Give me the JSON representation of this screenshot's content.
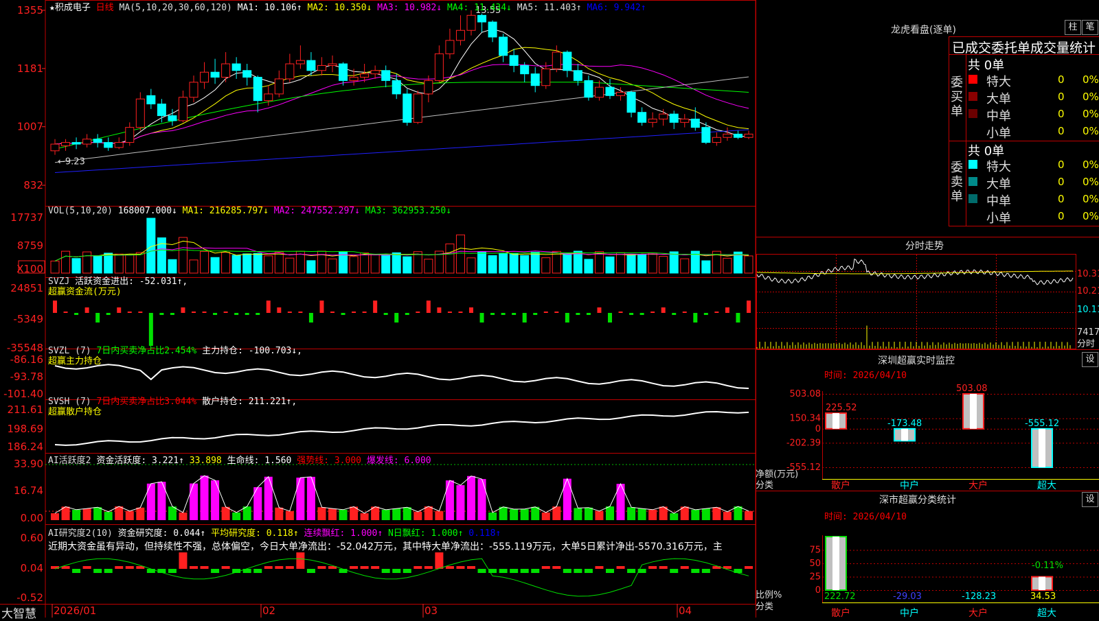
{
  "stock": {
    "star": "★",
    "name": "积成电子",
    "period": "日线"
  },
  "price_header": {
    "ma_spec": "MA(5,10,20,30,60,120)",
    "ma1": "MA1: 10.106↑",
    "ma2": "MA2: 10.350↓",
    "ma3": "MA3: 10.982↓",
    "ma4": "MA4: 11.434↓",
    "ma5": "MA5: 11.403↑",
    "ma6": "MA6: 9.942↑"
  },
  "price_axis": [
    "1355",
    "1181",
    "1007",
    "832"
  ],
  "price_annotations": {
    "high": "13.55",
    "low": "9.23"
  },
  "vol_header": {
    "spec": "VOL(5,10,20)",
    "value": "168007.000↓",
    "ma1": "MA1: 216285.797↓",
    "ma2": "MA2: 247552.297↓",
    "ma3": "MA3: 362953.250↓"
  },
  "vol_axis": [
    "17737",
    "8759",
    "X100"
  ],
  "svzj": {
    "title": "SVZJ",
    "desc": "活跃资金进出: -52.031↑,",
    "sub": "超赢资金流(万元)",
    "axis": [
      "24851",
      "-5349",
      "-35548"
    ]
  },
  "svzl": {
    "title": "SVZL (7)",
    "a": "7日内买卖净占比2.454%",
    "b": "主力持仓: -100.703↓,",
    "sub": "超赢主力持仓",
    "axis": [
      "-86.16",
      "-93.78",
      "-101.40"
    ]
  },
  "svsh": {
    "title": "SVSH (7)",
    "a": "7日内买卖净占比3.044%",
    "b": "散户持仓: 211.221↑,",
    "sub": "超赢散户持仓",
    "axis": [
      "211.61",
      "198.69",
      "186.24"
    ]
  },
  "ai2": {
    "title": "AI活跃度2",
    "a": "资金活跃度: 3.221↑",
    "b": "33.898",
    "c": "生命线: 1.560",
    "d": "强势线: 3.000",
    "e": "爆发线: 6.000",
    "axis": [
      "33.90",
      "16.74",
      "0.00"
    ]
  },
  "ai_research": {
    "title": "AI研究度2(10)",
    "a": "资金研究度: 0.044↑",
    "b": "平均研究度: 0.118↑",
    "c": "连续飘红: 1.000↑",
    "d": "N日飘红: 1.000↑",
    "e": "0.118↑",
    "text": "近期大资金虽有异动，但持续性不强，总体偏空，今日大单净流出：-52.042万元，其中特大单净流出：-555.119万元，大单5日累计净出-5570.316万元，主",
    "axis": [
      "0.60",
      "0.04",
      "-0.52"
    ]
  },
  "date_axis": [
    "2026/01",
    "02",
    "03",
    "04"
  ],
  "brand": "大智慧",
  "side": {
    "lhb_title": "龙虎看盘(逐单)",
    "btn_zhu": "柱",
    "btn_bi": "笔",
    "deal_header": "已成交委托单成交量统计",
    "buy_label": "委买单",
    "sell_label": "委卖单",
    "buy_total": "共 0单",
    "sell_total": "共 0单",
    "buy_rows": [
      {
        "name": "特大",
        "count": "0",
        "pct": "0%",
        "color": "#ff0000"
      },
      {
        "name": "大单",
        "count": "0",
        "pct": "0%",
        "color": "#8b0000"
      },
      {
        "name": "中单",
        "count": "0",
        "pct": "0%",
        "color": "#6b0000"
      },
      {
        "name": "小单",
        "count": "0",
        "pct": "0%",
        "color": ""
      }
    ],
    "sell_rows": [
      {
        "name": "特大",
        "count": "0",
        "pct": "0%",
        "color": "#00ffff"
      },
      {
        "name": "大单",
        "count": "0",
        "pct": "0%",
        "color": "#008b8b"
      },
      {
        "name": "中单",
        "count": "0",
        "pct": "0%",
        "color": "#006b6b"
      },
      {
        "name": "小单",
        "count": "0",
        "pct": "0%",
        "color": ""
      }
    ],
    "intraday_title": "分时走势",
    "intraday_axis": [
      "10.31",
      "10.21",
      "10.11"
    ],
    "intraday_vol": "7417",
    "intraday_vol_unit": "分时",
    "monitor_title": "深圳超赢实时监控",
    "monitor_time": "时间: 2026/04/10",
    "btn_set": "设",
    "monitor_axis": [
      "503.08",
      "150.34",
      "0",
      "-202.39",
      "-555.12"
    ],
    "monitor_ylabel": "净额(万元)",
    "monitor_xlabel": "分类",
    "class_title": "深市超赢分类统计",
    "class_time": "时间: 2026/04/10",
    "class_axis": [
      "75",
      "50",
      "25",
      "0"
    ],
    "class_ylabel": "比例%",
    "class_xlabel": "分类"
  },
  "chart_data": [
    {
      "type": "bar",
      "title": "深圳超赢实时监控",
      "categories": [
        "散户",
        "中户",
        "大户",
        "超大"
      ],
      "values": [
        225.52,
        -173.48,
        503.08,
        -555.12
      ],
      "ylabel": "净额(万元)",
      "xlabel": "分类",
      "ylim": [
        -555.12,
        503.08
      ]
    },
    {
      "type": "bar",
      "title": "深市超赢分类统计",
      "categories": [
        "散户",
        "中户",
        "大户",
        "超大"
      ],
      "values": [
        222.72,
        -29.03,
        -128.23,
        34.53
      ],
      "bar_label": "-0.11%",
      "ylabel": "比例%",
      "xlabel": "分类",
      "ylim": [
        0,
        100
      ]
    },
    {
      "type": "candlestick",
      "title": "积成电子 日线",
      "x": [
        "2026/01",
        "02",
        "03",
        "04"
      ],
      "ylim": [
        8.32,
        13.55
      ],
      "high": 13.55,
      "low": 9.23,
      "candles": [
        {
          "o": 9.35,
          "c": 9.55,
          "h": 9.7,
          "l": 9.23
        },
        {
          "o": 9.5,
          "c": 9.6,
          "h": 9.7,
          "l": 9.35
        },
        {
          "o": 9.6,
          "c": 9.55,
          "h": 9.75,
          "l": 9.4
        },
        {
          "o": 9.55,
          "c": 9.7,
          "h": 9.85,
          "l": 9.45
        },
        {
          "o": 9.7,
          "c": 9.6,
          "h": 9.85,
          "l": 9.45
        },
        {
          "o": 9.6,
          "c": 9.45,
          "h": 9.75,
          "l": 9.35
        },
        {
          "o": 9.45,
          "c": 9.6,
          "h": 9.75,
          "l": 9.4
        },
        {
          "o": 9.6,
          "c": 10.05,
          "h": 10.2,
          "l": 9.5
        },
        {
          "o": 10.05,
          "c": 10.9,
          "h": 11.1,
          "l": 9.95
        },
        {
          "o": 11.0,
          "c": 10.75,
          "h": 11.2,
          "l": 10.6
        },
        {
          "o": 10.75,
          "c": 10.4,
          "h": 10.9,
          "l": 10.2
        },
        {
          "o": 10.4,
          "c": 10.25,
          "h": 10.6,
          "l": 10.1
        },
        {
          "o": 10.25,
          "c": 10.95,
          "h": 11.15,
          "l": 10.2
        },
        {
          "o": 10.95,
          "c": 11.4,
          "h": 11.6,
          "l": 10.8
        },
        {
          "o": 11.4,
          "c": 11.7,
          "h": 12.0,
          "l": 11.2
        },
        {
          "o": 11.7,
          "c": 11.55,
          "h": 12.1,
          "l": 11.35
        },
        {
          "o": 11.55,
          "c": 11.95,
          "h": 12.3,
          "l": 11.4
        },
        {
          "o": 11.95,
          "c": 11.75,
          "h": 12.15,
          "l": 11.5
        },
        {
          "o": 11.75,
          "c": 11.55,
          "h": 11.95,
          "l": 11.3
        },
        {
          "o": 11.55,
          "c": 10.85,
          "h": 11.6,
          "l": 10.5
        },
        {
          "o": 10.85,
          "c": 11.05,
          "h": 11.3,
          "l": 10.7
        },
        {
          "o": 11.05,
          "c": 11.5,
          "h": 11.75,
          "l": 10.95
        },
        {
          "o": 11.5,
          "c": 11.95,
          "h": 12.25,
          "l": 11.4
        },
        {
          "o": 11.95,
          "c": 12.05,
          "h": 12.5,
          "l": 11.8
        },
        {
          "o": 12.05,
          "c": 11.75,
          "h": 12.3,
          "l": 11.6
        },
        {
          "o": 11.75,
          "c": 11.9,
          "h": 12.15,
          "l": 11.6
        },
        {
          "o": 11.9,
          "c": 11.95,
          "h": 12.2,
          "l": 11.7
        },
        {
          "o": 11.95,
          "c": 11.45,
          "h": 12.0,
          "l": 11.3
        },
        {
          "o": 11.45,
          "c": 11.55,
          "h": 11.8,
          "l": 11.3
        },
        {
          "o": 11.55,
          "c": 11.65,
          "h": 11.95,
          "l": 11.4
        },
        {
          "o": 11.65,
          "c": 11.75,
          "h": 11.9,
          "l": 11.5
        },
        {
          "o": 11.75,
          "c": 11.45,
          "h": 11.9,
          "l": 11.25
        },
        {
          "o": 11.45,
          "c": 11.05,
          "h": 11.65,
          "l": 10.9
        },
        {
          "o": 11.05,
          "c": 10.2,
          "h": 11.2,
          "l": 10.1
        },
        {
          "o": 10.2,
          "c": 11.05,
          "h": 11.15,
          "l": 10.15
        },
        {
          "o": 11.05,
          "c": 11.45,
          "h": 11.6,
          "l": 10.8
        },
        {
          "o": 11.45,
          "c": 12.25,
          "h": 12.5,
          "l": 11.4
        },
        {
          "o": 12.25,
          "c": 12.65,
          "h": 13.0,
          "l": 12.1
        },
        {
          "o": 12.65,
          "c": 12.95,
          "h": 13.4,
          "l": 12.5
        },
        {
          "o": 12.95,
          "c": 13.4,
          "h": 13.55,
          "l": 12.8
        },
        {
          "o": 13.4,
          "c": 13.2,
          "h": 13.45,
          "l": 12.9
        },
        {
          "o": 13.2,
          "c": 12.75,
          "h": 13.25,
          "l": 12.6
        },
        {
          "o": 12.75,
          "c": 12.2,
          "h": 12.85,
          "l": 12.0
        },
        {
          "o": 12.2,
          "c": 11.9,
          "h": 12.4,
          "l": 11.7
        },
        {
          "o": 11.9,
          "c": 11.65,
          "h": 12.0,
          "l": 11.4
        },
        {
          "o": 11.65,
          "c": 11.3,
          "h": 11.85,
          "l": 11.1
        },
        {
          "o": 11.3,
          "c": 11.8,
          "h": 12.0,
          "l": 11.2
        },
        {
          "o": 11.8,
          "c": 12.3,
          "h": 12.5,
          "l": 11.7
        },
        {
          "o": 12.3,
          "c": 11.75,
          "h": 12.35,
          "l": 11.55
        },
        {
          "o": 11.75,
          "c": 11.45,
          "h": 11.95,
          "l": 11.3
        },
        {
          "o": 11.45,
          "c": 10.95,
          "h": 11.6,
          "l": 10.85
        },
        {
          "o": 10.95,
          "c": 11.25,
          "h": 11.45,
          "l": 10.85
        },
        {
          "o": 11.25,
          "c": 11.0,
          "h": 11.5,
          "l": 10.9
        },
        {
          "o": 11.0,
          "c": 11.1,
          "h": 11.25,
          "l": 10.85
        },
        {
          "o": 11.1,
          "c": 10.5,
          "h": 11.15,
          "l": 10.35
        },
        {
          "o": 10.5,
          "c": 10.2,
          "h": 10.65,
          "l": 10.1
        },
        {
          "o": 10.2,
          "c": 10.3,
          "h": 10.5,
          "l": 10.05
        },
        {
          "o": 10.3,
          "c": 10.45,
          "h": 10.6,
          "l": 10.1
        },
        {
          "o": 10.45,
          "c": 10.2,
          "h": 10.55,
          "l": 10.0
        },
        {
          "o": 10.2,
          "c": 10.3,
          "h": 10.45,
          "l": 10.05
        },
        {
          "o": 10.3,
          "c": 10.05,
          "h": 10.65,
          "l": 9.95
        },
        {
          "o": 10.05,
          "c": 9.6,
          "h": 10.2,
          "l": 9.55
        },
        {
          "o": 9.6,
          "c": 9.75,
          "h": 9.9,
          "l": 9.5
        },
        {
          "o": 9.75,
          "c": 9.85,
          "h": 10.05,
          "l": 9.65
        },
        {
          "o": 9.85,
          "c": 9.75,
          "h": 9.95,
          "l": 9.7
        },
        {
          "o": 9.75,
          "c": 9.85,
          "h": 9.95,
          "l": 9.7
        }
      ]
    }
  ]
}
